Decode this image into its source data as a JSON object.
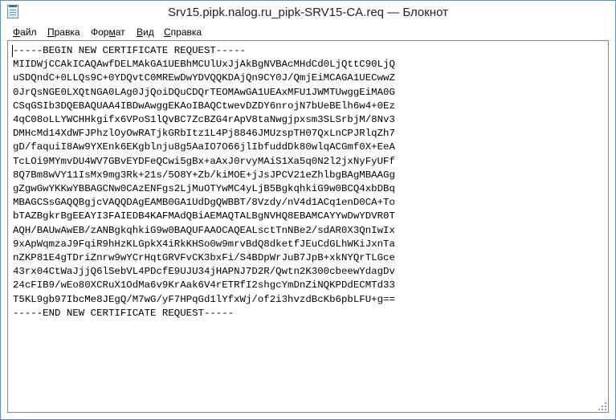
{
  "window": {
    "title": "Srv15.pipk.nalog.ru_pipk-SRV15-CA.req — Блокнот"
  },
  "menu": {
    "items": [
      {
        "accel": "Ф",
        "rest": "айл"
      },
      {
        "accel": "П",
        "rest": "равка"
      },
      {
        "accel": "",
        "pre": "Фор",
        "mid": "м",
        "rest": "ат"
      },
      {
        "accel": "В",
        "rest": "ид"
      },
      {
        "accel": "С",
        "rest": "правка"
      }
    ]
  },
  "editor": {
    "lines": [
      "-----BEGIN NEW CERTIFICATE REQUEST-----",
      "MIIDWjCCAkICAQAwfDELMAkGA1UEBhMCUlUxJjAkBgNVBAcMHdCd0LjQttC90LjQ",
      "uSDQndC+0LLQs9C+0YDQvtC0MREwDwYDVQQKDAjQn9CY0J/QmjEiMCAGA1UECwwZ",
      "0JrQsNGE0LXQtNGA0LAg0JjQoiDQuCDQrTEOMAwGA1UEAxMFU1JWMTUwggEiMA0G",
      "CSqGSIb3DQEBAQUAA4IBDwAwggEKAoIBAQCtwevDZDY6nrojN7bUeBElh6w4+0Ez",
      "4qC08oLLYWCHHkgifx6VPoS1lQvBC7ZcBZG4rApV8taNwgjpxsm3SLSrbjM/8Nv3",
      "DMHcMd14XdWFJPhzlOyOwRATjkGRbItz1L4Pj8846JMUzspTH07QxLnCPJRlqZh7",
      "gD/faquiI8Aw9YXEnk6EKgblnju8g5AaIO7O66jlIbfuddDk80wlqACGmf0X+EeA",
      "TcLOi9MYmvDU4WV7GBvEYDFeQCwi5gBx+aAxJ0rvyMAiS1Xa5q0N2l2jxNyFyUFf",
      "8Q7Bm8wVY11IsMx9mg3Rk+21s/5O8Y+Zb/kiMOE+jJsJPCV21eZhlbgBAgMBAAGg",
      "gZgwGwYKKwYBBAGCNw0CAzENFgs2LjMuOTYwMC4yLjB5BgkqhkiG9w0BCQ4xbDBq",
      "MBAGCSsGAQQBgjcVAQQDAgEAMB0GA1UdDgQWBBT/8Vzdy/nV4d1ACq1enD0CA+To",
      "bTAZBgkrBgEEAYI3FAIEDB4KAFMAdQBiAEMAQTALBgNVHQ8EBAMCAYYwDwYDVR0T",
      "AQH/BAUwAwEB/zANBgkqhkiG9w0BAQUFAAOCAQEALsctTnNBe2/sdAR0X3QnIwIx",
      "9xApWqmzaJ9FqiR9hHzKLGpkX4iRkKHSo0w9mrvBdQ8dketfJEuCdGLhWKiJxnTa",
      "nZKP81E4gTDriZnrw9wYCrHqtGRVFvCK3bxFi/S4BDpWrJuB7JpB+xkNYQrTLGce",
      "43rx04CtWaJjjQ6lSebVL4PDcfE9UJU34jHAPNJ7D2R/Qwtn2K300cbeewYdagDv",
      "24cFIB9/wEo80XCRuX1OdMa6v9KrAak6V4rETRfI2shgcYmDnZiNQKPDdECMTd33",
      "T5KL9gb97IbcMe8JEgQ/M7wG/yF7HPqGd1lYfxWj/of2i3hvzdBcKb6pbLFU+g==",
      "-----END NEW CERTIFICATE REQUEST-----"
    ]
  }
}
